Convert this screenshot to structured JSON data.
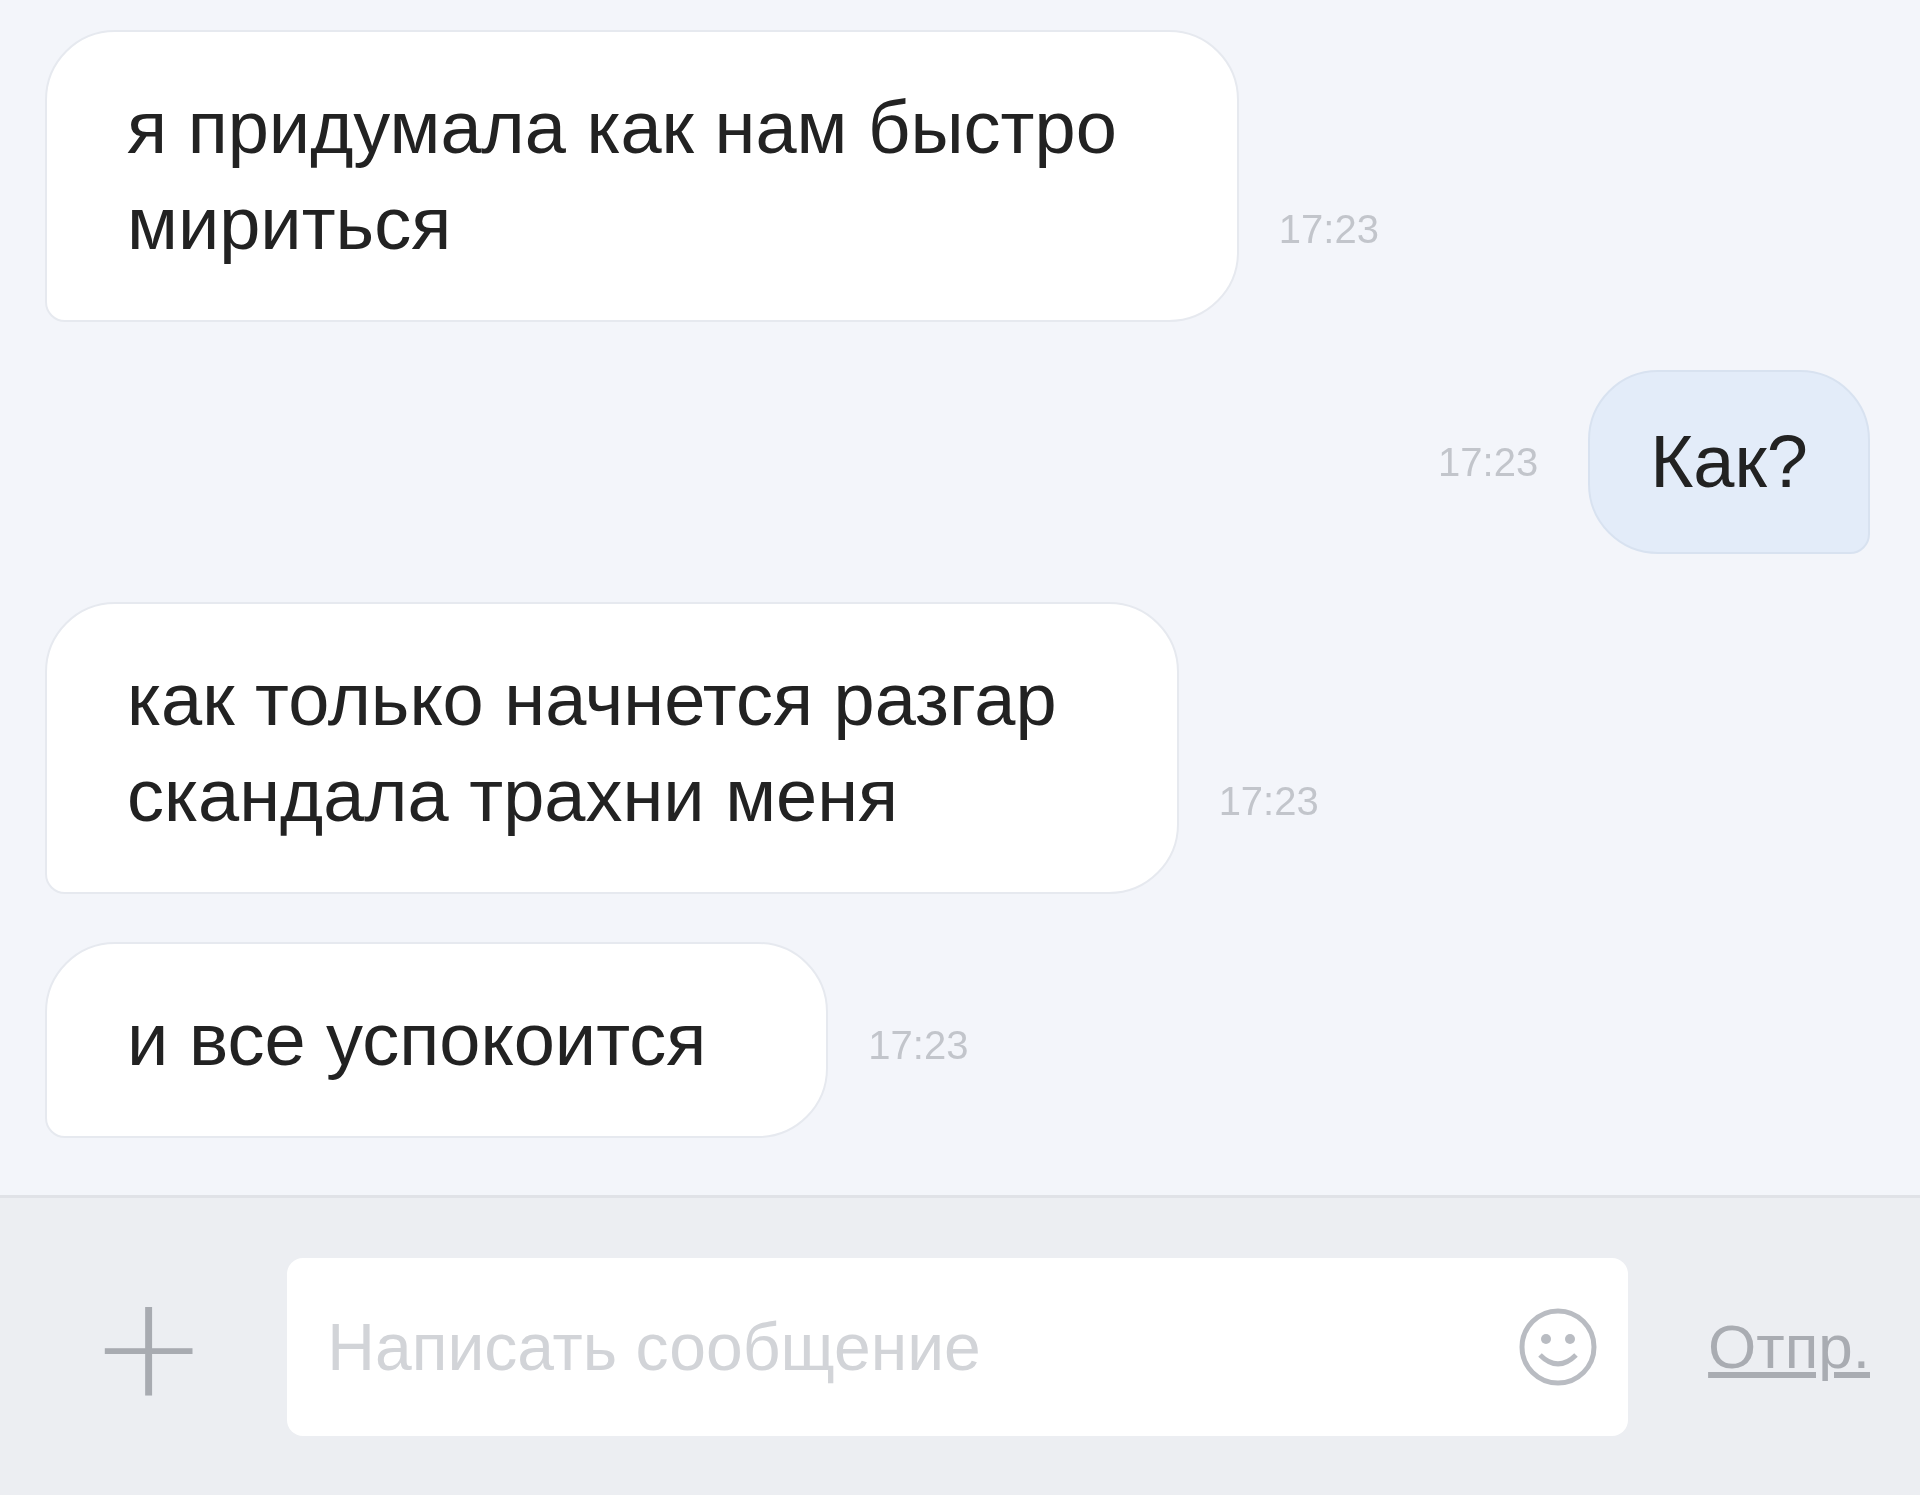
{
  "messages": [
    {
      "kind": "incoming",
      "text": "я придумала как нам быстро\nмириться",
      "time": "17:23"
    },
    {
      "kind": "outgoing",
      "text": "Как?",
      "time": "17:23"
    },
    {
      "kind": "incoming",
      "text": "как только начнется разгар\nскандала трахни меня",
      "time": "17:23"
    },
    {
      "kind": "incoming",
      "text": "и все успокоится",
      "time": "17:23"
    }
  ],
  "composer": {
    "attach": "+",
    "placeholder": "Написать сообщение",
    "send": "Отпр."
  }
}
